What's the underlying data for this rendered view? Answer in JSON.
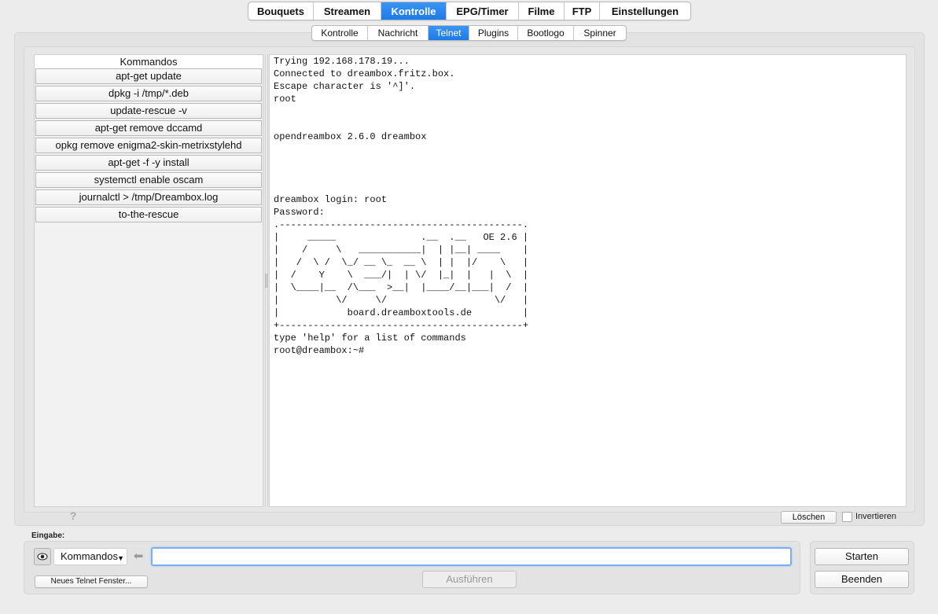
{
  "main_tabs": [
    "Bouquets",
    "Streamen",
    "Kontrolle",
    "EPG/Timer",
    "Filme",
    "FTP",
    "Einstellungen"
  ],
  "main_tab_active": "Kontrolle",
  "sub_tabs": [
    "Kontrolle",
    "Nachricht",
    "Telnet",
    "Plugins",
    "Bootlogo",
    "Spinner"
  ],
  "sub_tab_active": "Telnet",
  "commands": {
    "header": "Kommandos",
    "items": [
      "apt-get update",
      "dpkg -i /tmp/*.deb",
      "update-rescue -v",
      "apt-get remove dccamd",
      "opkg remove enigma2-skin-metrixstylehd",
      "apt-get -f -y install",
      "systemctl enable oscam",
      "journalctl > /tmp/Dreambox.log",
      "to-the-rescue"
    ]
  },
  "terminal": {
    "output": "Trying 192.168.178.19...\nConnected to dreambox.fritz.box.\nEscape character is '^]'.\nroot\n\n\nopendreambox 2.6.0 dreambox\n\n\n\n\ndreambox login: root\nPassword:\n.-------------------------------------------.\n|     _____               .__  .__   OE 2.6 |\n|    /     \\   ___________|  | |__| ____    |\n|   /  \\ /  \\_/ __ \\_  __ \\  | |  |/    \\   |\n|  /    Y    \\  ___/|  | \\/  |_|  |   |  \\  |\n|  \\____|__  /\\___  >__|  |____/__|___|  /  |\n|          \\/     \\/                   \\/   |\n|            board.dreamboxtools.de         |\n+-------------------------------------------+\ntype 'help' for a list of commands\nroot@dreambox:~#"
  },
  "help_icon": "?",
  "loeschen_label": "Löschen",
  "invertieren_label": "Invertieren",
  "invertieren_checked": false,
  "eingabe_label": "Eingabe:",
  "eye_icon": "eye-icon",
  "dropdown_value": "Kommandos",
  "back_icon": "back-arrow-icon",
  "command_input_value": "",
  "neues_telnet_label": "Neues Telnet Fenster...",
  "ausfuehren_label": "Ausführen",
  "starten_label": "Starten",
  "beenden_label": "Beenden",
  "colors": {
    "accent": "#1e7ae6",
    "input_focus": "#7aaef4"
  }
}
